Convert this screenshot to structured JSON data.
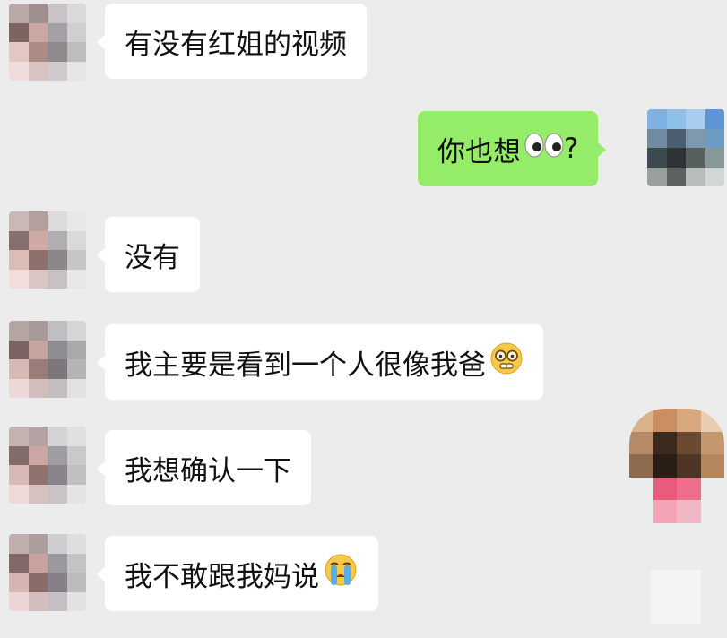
{
  "messages": [
    {
      "id": "m1",
      "side": "in",
      "text": "有没有红姐的视频",
      "emoji": ""
    },
    {
      "id": "m2",
      "side": "out",
      "text": "你也想",
      "emoji": "eyes-icon",
      "suffix": "?"
    },
    {
      "id": "m3",
      "side": "in",
      "text": "没有",
      "emoji": ""
    },
    {
      "id": "m4",
      "side": "in",
      "text": "我主要是看到一个人很像我爸",
      "emoji": "grimace-glasses-icon"
    },
    {
      "id": "m5",
      "side": "in",
      "text": "我想确认一下",
      "emoji": ""
    },
    {
      "id": "m6",
      "side": "in",
      "text": "我不敢跟我妈说",
      "emoji": "crying-face-icon"
    }
  ],
  "colors": {
    "background": "#ececec",
    "incoming_bubble": "#ffffff",
    "outgoing_bubble": "#95ec69",
    "text": "#111111"
  }
}
